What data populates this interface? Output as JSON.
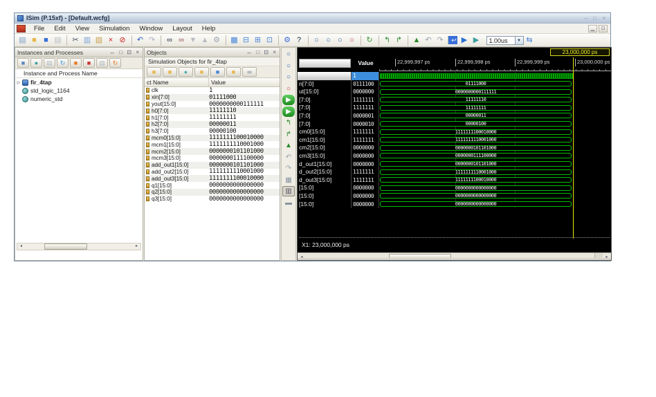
{
  "window": {
    "title": "ISim (P.15xf) - [Default.wcfg]",
    "controls": "– □ ×"
  },
  "menu": {
    "items": [
      "File",
      "Edit",
      "View",
      "Simulation",
      "Window",
      "Layout",
      "Help"
    ]
  },
  "main_toolbar": {
    "time_value": "1.00us",
    "icons": [
      {
        "n": "new-icon",
        "g": "▤",
        "c": "#7a9cc6"
      },
      {
        "n": "open-icon",
        "g": "■",
        "c": "#e8b84c"
      },
      {
        "n": "save-icon",
        "g": "■",
        "c": "#3a6fd8"
      },
      {
        "n": "print-icon",
        "g": "▤",
        "c": "#b8bcc2"
      },
      {
        "n": "cut-icon",
        "g": "✂",
        "c": "#445566",
        "sep": "sep"
      },
      {
        "n": "copy-icon",
        "g": "▥",
        "c": "#7aa0d8"
      },
      {
        "n": "paste-icon",
        "g": "▧",
        "c": "#c8a050"
      },
      {
        "n": "delete-icon",
        "g": "×",
        "c": "#cc2222"
      },
      {
        "n": "disable-icon",
        "g": "⊘",
        "c": "#cc2222"
      },
      {
        "n": "undo-icon",
        "g": "↶",
        "c": "#2a5fc0",
        "sep": "sep"
      },
      {
        "n": "redo-icon",
        "g": "↷",
        "c": "#aab4c0"
      },
      {
        "n": "find-icon",
        "g": "∞",
        "c": "#223344",
        "sep": "sep"
      },
      {
        "n": "find-remove-icon",
        "g": "∞",
        "c": "#995555"
      },
      {
        "n": "goto-down-icon",
        "g": "▼",
        "c": "#b8bcc2"
      },
      {
        "n": "goto-up-icon",
        "g": "▲",
        "c": "#b8bcc2"
      },
      {
        "n": "settings-gear-icon",
        "g": "⚙",
        "c": "#9aa4ae"
      },
      {
        "n": "cascade-windows-icon",
        "g": "▩",
        "c": "#4a86d8",
        "sep": "sep"
      },
      {
        "n": "tile-horizontal-icon",
        "g": "⊟",
        "c": "#4a86d8"
      },
      {
        "n": "tile-vertical-icon",
        "g": "⊞",
        "c": "#4a86d8"
      },
      {
        "n": "layout-icon",
        "g": "⊡",
        "c": "#4a86d8"
      },
      {
        "n": "wrench-icon",
        "g": "⚙",
        "c": "#3a6fd8",
        "sep": "sep"
      },
      {
        "n": "whats-this-icon",
        "g": "?",
        "c": "#223344"
      },
      {
        "n": "zoom-in-icon",
        "g": "○",
        "c": "#2a5faa",
        "sep": "sep"
      },
      {
        "n": "zoom-out-icon",
        "g": "○",
        "c": "#2a5faa"
      },
      {
        "n": "zoom-full-icon",
        "g": "○",
        "c": "#2a5faa"
      },
      {
        "n": "zoom-cursor-icon",
        "g": "○",
        "c": "#cc3333"
      },
      {
        "n": "refresh-icon",
        "g": "↻",
        "c": "#3a9a3a",
        "sep": "sep"
      },
      {
        "n": "prev-event-icon",
        "g": "↰",
        "c": "#2a8a2a",
        "sep": "sep"
      },
      {
        "n": "next-event-icon",
        "g": "↱",
        "c": "#2a8a2a"
      },
      {
        "n": "restart-icon",
        "g": "▲",
        "c": "#2a8a2a",
        "sep": "sep"
      },
      {
        "n": "run-back-icon",
        "g": "↶",
        "c": "#99a4ae"
      },
      {
        "n": "run-forward-icon",
        "g": "↷",
        "c": "#99a4ae"
      },
      {
        "n": "goto-time-icon",
        "g": "↩",
        "c": "#ffffff",
        "sep": "sep",
        "cls": "chipblue"
      },
      {
        "n": "run-all-icon",
        "g": "▶",
        "c": "#2a6fd0"
      },
      {
        "n": "run-for-time-icon",
        "g": "▶",
        "c": "#3aa0a0"
      }
    ],
    "after_time_icon": {
      "n": "step-icon",
      "g": "⇆",
      "c": "#4a86d8"
    },
    "dropdown_glyph": "▼"
  },
  "instances_panel": {
    "title": "Instances and Processes",
    "window_buttons": "↔ □ ⊡ ×",
    "column_header": "Instance and Process Name",
    "toolbar_icons": [
      {
        "n": "instance-icon",
        "g": "■",
        "c": "#5b87c6"
      },
      {
        "n": "package-icon",
        "g": "●",
        "c": "#3aa0a0"
      },
      {
        "n": "source-icon",
        "g": "▤",
        "c": "#b0bcc8"
      },
      {
        "n": "reload-icon",
        "g": "↻",
        "c": "#4aa0e0"
      },
      {
        "n": "break-icon",
        "g": "■",
        "c": "#e87820"
      },
      {
        "n": "pur-icon",
        "g": "■",
        "c": "#cc3333"
      },
      {
        "n": "page-icon",
        "g": "▤",
        "c": "#b0bcc8"
      },
      {
        "n": "refresh-orange-icon",
        "g": "↻",
        "c": "#e87820"
      }
    ],
    "tree": [
      {
        "expander": "▷",
        "label": "fir_4tap",
        "icon": "inst",
        "cls": "bold"
      },
      {
        "expander": "",
        "label": "std_logic_1164",
        "icon": "pkg",
        "cls": ""
      },
      {
        "expander": "",
        "label": "numeric_std",
        "icon": "pkg",
        "cls": ""
      }
    ],
    "scroll_left_arrow": "◂",
    "scroll_right_arrow": "▸"
  },
  "objects_panel": {
    "title": "Objects",
    "window_buttons": "↔ □ ⊡ ×",
    "subtitle": "Simulation Objects for fir_4tap",
    "toolbar_icons": [
      {
        "n": "filter-input-icon",
        "g": "■",
        "c": "#e8b84c"
      },
      {
        "n": "filter-output-icon",
        "g": "■",
        "c": "#e8b84c"
      },
      {
        "n": "filter-inout-icon",
        "g": "●",
        "c": "#52b0b0"
      },
      {
        "n": "filter-internal-icon",
        "g": "■",
        "c": "#e8b84c"
      },
      {
        "n": "filter-constant-icon",
        "g": "■",
        "c": "#4a86d8"
      },
      {
        "n": "filter-variable-icon",
        "g": "■",
        "c": "#e8b84c"
      },
      {
        "n": "search-objects-icon",
        "g": "∞",
        "c": "#667788"
      }
    ],
    "columns": [
      "ct Name",
      "Value"
    ],
    "rows": [
      {
        "name": "clk",
        "value": "1"
      },
      {
        "name": "xin[7:0]",
        "value": "01111000"
      },
      {
        "name": "yout[15:0]",
        "value": "0000000000111111"
      },
      {
        "name": "h0[7:0]",
        "value": "11111110"
      },
      {
        "name": "h1[7:0]",
        "value": "11111111"
      },
      {
        "name": "h2[7:0]",
        "value": "00000011"
      },
      {
        "name": "h3[7:0]",
        "value": "00000100"
      },
      {
        "name": "mcm0[15:0]",
        "value": "1111111100010000"
      },
      {
        "name": "mcm1[15:0]",
        "value": "1111111110001000"
      },
      {
        "name": "mcm2[15:0]",
        "value": "0000000101101000"
      },
      {
        "name": "mcm3[15:0]",
        "value": "0000000111100000"
      },
      {
        "name": "add_out1[15:0]",
        "value": "0000000101101000"
      },
      {
        "name": "add_out2[15:0]",
        "value": "1111111110001000"
      },
      {
        "name": "add_out3[15:0]",
        "value": "1111111100010000"
      },
      {
        "name": "q1[15:0]",
        "value": "0000000000000000"
      },
      {
        "name": "q2[15:0]",
        "value": "0000000000000000"
      },
      {
        "name": "q3[15:0]",
        "value": "0000000000000000"
      }
    ]
  },
  "wave_toolbar_icons": [
    {
      "n": "zoom-in-icon",
      "g": "○",
      "c": "#2a5faa"
    },
    {
      "n": "zoom-out-icon",
      "g": "○",
      "c": "#2a5faa"
    },
    {
      "n": "zoom-full-icon",
      "g": "○",
      "c": "#2a5faa"
    },
    {
      "n": "zoom-cursor-icon",
      "g": "○",
      "c": "#cc3333"
    },
    {
      "n": "goto-time-zero-icon",
      "g": "▶",
      "c": "#ffffff",
      "cls": "chipgreen"
    },
    {
      "n": "goto-time-end-icon",
      "g": "▶",
      "c": "#ffffff",
      "cls": "chipgreen"
    },
    {
      "n": "prev-transition-icon",
      "g": "↰",
      "c": "#2a8a2a"
    },
    {
      "n": "next-transition-icon",
      "g": "↱",
      "c": "#2a8a2a"
    },
    {
      "n": "add-marker-icon",
      "g": "▲",
      "c": "#2a8a2a"
    },
    {
      "n": "undo-icon",
      "g": "↶",
      "c": "#99a4ae"
    },
    {
      "n": "redo-icon",
      "g": "↷",
      "c": "#99a4ae"
    },
    {
      "n": "snap-icon",
      "g": "▦",
      "c": "#8a94a0"
    },
    {
      "n": "measure-marker-icon",
      "g": "▥",
      "c": "#556",
      "cls": "pressed"
    },
    {
      "n": "keyboard-icon",
      "g": "▬",
      "c": "#8a94a0"
    }
  ],
  "wave_panel": {
    "cursor_tooltip": "23,000,000 ps",
    "value_header": "Value",
    "ticks": [
      "22,999,997 ps",
      "22,999,998 ps",
      "22,999,999 ps",
      "23,000,000 ps"
    ],
    "x1_label": "X1: 23,000,000 ps",
    "signals": [
      {
        "name": "",
        "val": "1",
        "wave": "",
        "cls": "clock selected"
      },
      {
        "name": "n[7:0]",
        "val": "0111100",
        "wave": "01111000",
        "cls": ""
      },
      {
        "name": "ut[15:0]",
        "val": "0000000",
        "wave": "0000000000111111",
        "cls": ""
      },
      {
        "name": "[7:0]",
        "val": "1111111",
        "wave": "11111110",
        "cls": ""
      },
      {
        "name": "[7:0]",
        "val": "1111111",
        "wave": "11111111",
        "cls": ""
      },
      {
        "name": "[7:0]",
        "val": "0000001",
        "wave": "00000011",
        "cls": ""
      },
      {
        "name": "[7:0]",
        "val": "0000010",
        "wave": "00000100",
        "cls": ""
      },
      {
        "name": "cm0[15:0]",
        "val": "1111111",
        "wave": "1111111100010000",
        "cls": ""
      },
      {
        "name": "cm1[15:0]",
        "val": "1111111",
        "wave": "1111111110001000",
        "cls": ""
      },
      {
        "name": "cm2[15:0]",
        "val": "0000000",
        "wave": "0000000101101000",
        "cls": ""
      },
      {
        "name": "cm3[15:0]",
        "val": "0000000",
        "wave": "0000000111100000",
        "cls": ""
      },
      {
        "name": "d_out1[15:0]",
        "val": "0000000",
        "wave": "0000000101101000",
        "cls": ""
      },
      {
        "name": "d_out2[15:0]",
        "val": "1111111",
        "wave": "1111111110001000",
        "cls": ""
      },
      {
        "name": "d_out3[15:0]",
        "val": "1111111",
        "wave": "1111111100010000",
        "cls": ""
      },
      {
        "name": "[15:0]",
        "val": "0000000",
        "wave": "0000000000000000",
        "cls": ""
      },
      {
        "name": "[15:0]",
        "val": "0000000",
        "wave": "0000000000000000",
        "cls": ""
      },
      {
        "name": "[15:0]",
        "val": "0000000",
        "wave": "0000000000000000",
        "cls": ""
      }
    ],
    "colors": {
      "wave_green": "#00c000",
      "cursor_yellow": "#e8e800",
      "selected_blue": "#3d8edc"
    }
  }
}
